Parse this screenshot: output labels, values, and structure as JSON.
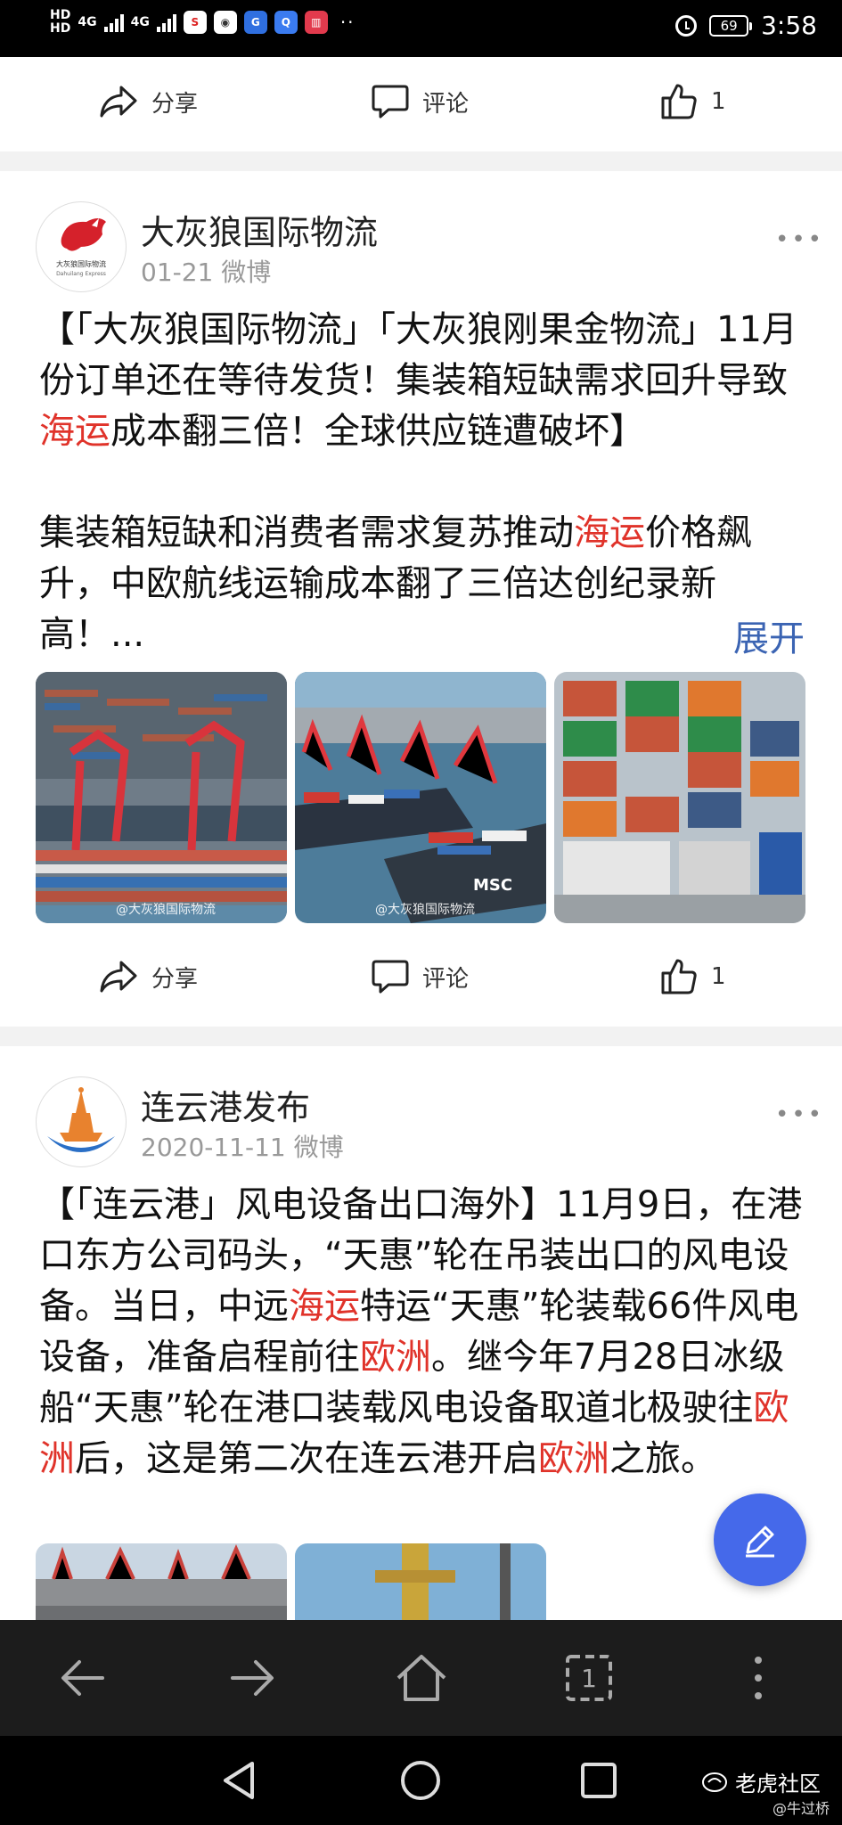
{
  "status_bar": {
    "hd_top": "HD",
    "hd_bottom": "HD",
    "network_1": "4G",
    "network_2": "4G",
    "battery": "69",
    "time": "3:58",
    "more_dots": "··"
  },
  "top_actions": {
    "share_label": "分享",
    "comment_label": "评论",
    "like_count": "1"
  },
  "post1": {
    "author": "大灰狼国际物流",
    "date_source": "01-21 微博",
    "avatar_caption": "大灰狼国际物流",
    "avatar_caption_en": "Dahuilang Express",
    "title_segments": [
      {
        "text": "【「大灰狼国际物流」「大灰狼刚果金物流」11月份订单还在等待发货！集装箱短缺需求回升导致",
        "hl": false
      },
      {
        "text": "海运",
        "hl": true
      },
      {
        "text": "成本翻三倍！全球供应链遭破坏】",
        "hl": false
      }
    ],
    "body_segments": [
      {
        "text": "集装箱短缺和消费者需求复苏推动",
        "hl": false
      },
      {
        "text": "海运",
        "hl": true
      },
      {
        "text": "价格飙升，中欧航线运输成本翻了三倍达创纪录新高！...",
        "hl": false
      }
    ],
    "expand_label": "展开",
    "image_watermark_1": "@大灰狼国际物流",
    "image_watermark_2": "@大灰狼国际物流",
    "share_label": "分享",
    "comment_label": "评论",
    "like_count": "1"
  },
  "post2": {
    "author": "连云港发布",
    "date_source": "2020-11-11 微博",
    "text_segments": [
      {
        "text": "【「连云港」风电设备出口海外】11月9日，在港口东方公司码头，“天惠”轮在吊装出口的风电设备。当日，中远",
        "hl": false
      },
      {
        "text": "海运",
        "hl": true
      },
      {
        "text": "特运“天惠”轮装载66件风电设备，准备启程前往",
        "hl": false
      },
      {
        "text": "欧洲",
        "hl": true
      },
      {
        "text": "。继今年7月28日冰级船“天惠”轮在港口装载风电设备取道北极驶往",
        "hl": false
      },
      {
        "text": "欧洲",
        "hl": true
      },
      {
        "text": "后，这是第二次在连云港开启",
        "hl": false
      },
      {
        "text": "欧洲",
        "hl": true
      },
      {
        "text": "之旅。",
        "hl": false
      }
    ]
  },
  "browser_toolbar": {
    "tab_count": "1"
  },
  "watermark": {
    "brand": "老虎社区",
    "handle": "@牛过桥"
  },
  "colors": {
    "highlight": "#e0332a",
    "link": "#3b64b3",
    "fab": "#4569ea"
  }
}
